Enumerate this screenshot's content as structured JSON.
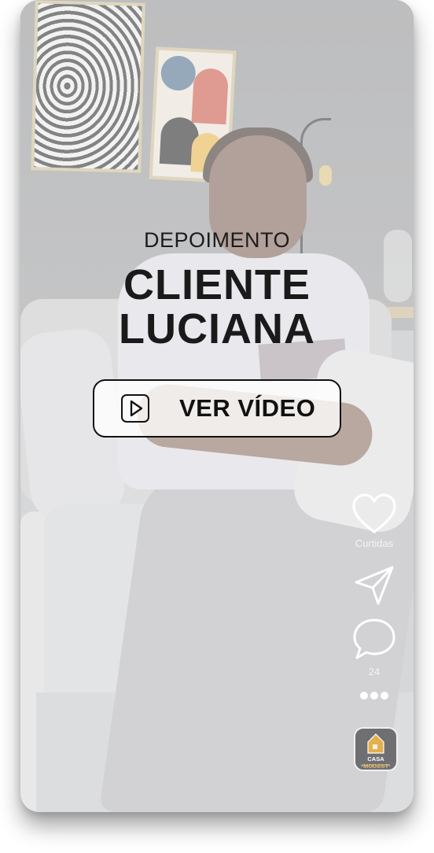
{
  "overlay": {
    "eyebrow": "DEPOIMENTO",
    "title_line1": "CLIENTE",
    "title_line2": "LUCIANA",
    "cta_label": "VER VÍDEO"
  },
  "actions": {
    "like_label": "Curtidas",
    "comment_count": "24"
  },
  "logo": {
    "brand_part1": "CASA ",
    "brand_part2": "MODEST",
    "tagline": "MÓVEIS E DECOR"
  },
  "colors": {
    "text_dark": "#1a1a1a",
    "icon_white": "#ffffff",
    "logo_accent": "#e2b04f"
  },
  "icons": [
    "play-icon",
    "heart-icon",
    "share-icon",
    "comment-icon",
    "more-icon",
    "house-icon"
  ]
}
